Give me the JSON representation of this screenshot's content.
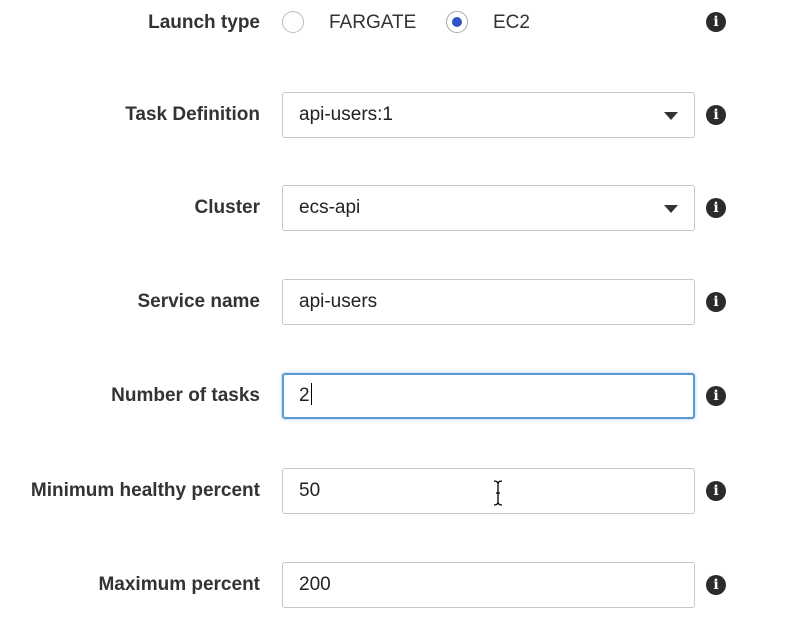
{
  "launch_type": {
    "label": "Launch type",
    "options": [
      {
        "label": "FARGATE",
        "selected": false
      },
      {
        "label": "EC2",
        "selected": true
      }
    ]
  },
  "task_definition": {
    "label": "Task Definition",
    "value": "api-users:1"
  },
  "cluster": {
    "label": "Cluster",
    "value": "ecs-api"
  },
  "service_name": {
    "label": "Service name",
    "value": "api-users"
  },
  "number_of_tasks": {
    "label": "Number of tasks",
    "value": "2"
  },
  "minimum_healthy_percent": {
    "label": "Minimum healthy percent",
    "value": "50"
  },
  "maximum_percent": {
    "label": "Maximum percent",
    "value": "200"
  },
  "info_icon_glyph": "i",
  "colors": {
    "radio_selected": "#2f55c8",
    "focus_border": "#5b9bd5"
  }
}
